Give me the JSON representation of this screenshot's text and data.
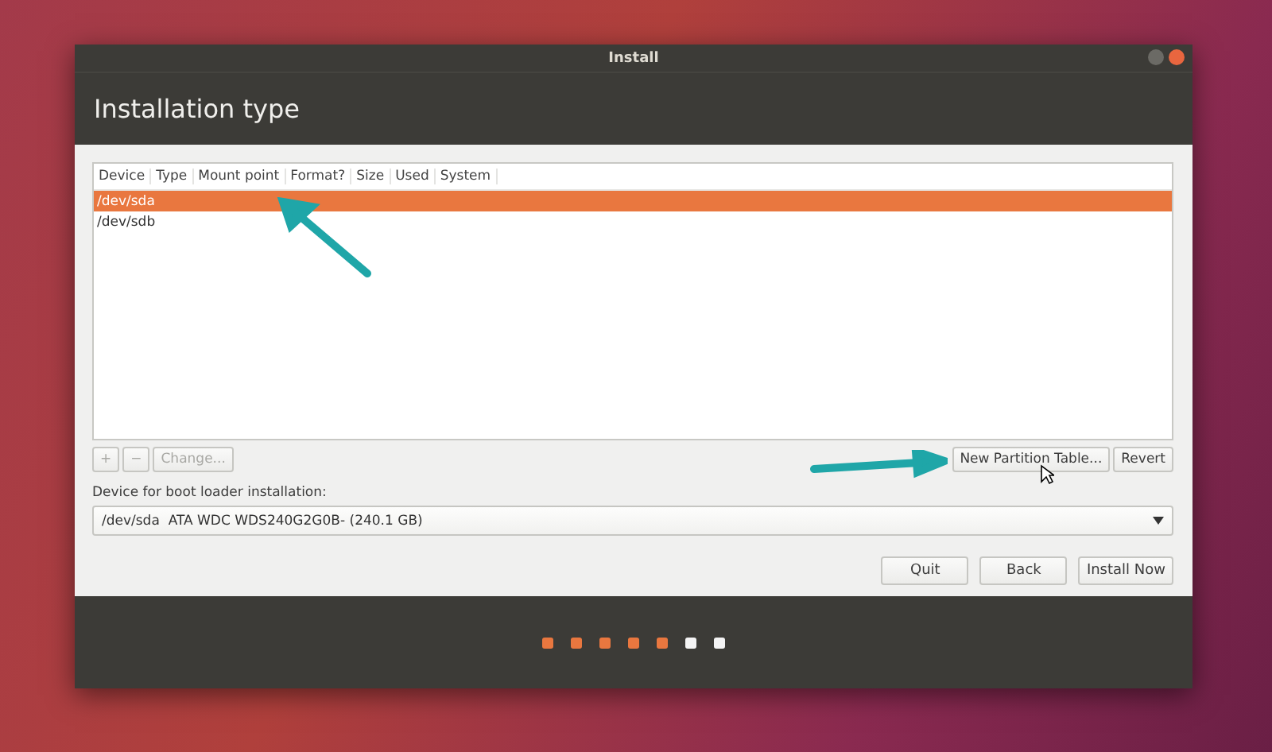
{
  "window": {
    "title": "Install"
  },
  "header": {
    "title": "Installation type"
  },
  "table": {
    "columns": [
      "Device",
      "Type",
      "Mount point",
      "Format?",
      "Size",
      "Used",
      "System"
    ],
    "rows": [
      {
        "device": "/dev/sda",
        "selected": true
      },
      {
        "device": "/dev/sdb",
        "selected": false
      }
    ]
  },
  "table_buttons": [
    {
      "label": "+",
      "disabled": true
    },
    {
      "label": "−",
      "disabled": true
    },
    {
      "label": "Change...",
      "disabled": true
    }
  ],
  "right_buttons": [
    {
      "label": "New Partition Table...",
      "disabled": false
    },
    {
      "label": "Revert",
      "disabled": false
    }
  ],
  "boot_loader": {
    "label": "Device for boot loader installation:",
    "value": "/dev/sda  ATA WDC WDS240G2G0B- (240.1 GB)"
  },
  "nav_buttons": [
    {
      "label": "Quit"
    },
    {
      "label": "Back"
    },
    {
      "label": "Install Now"
    }
  ],
  "steps": [
    {
      "done": true
    },
    {
      "done": true
    },
    {
      "done": true
    },
    {
      "done": true
    },
    {
      "done": true
    },
    {
      "done": false
    },
    {
      "done": false
    }
  ]
}
